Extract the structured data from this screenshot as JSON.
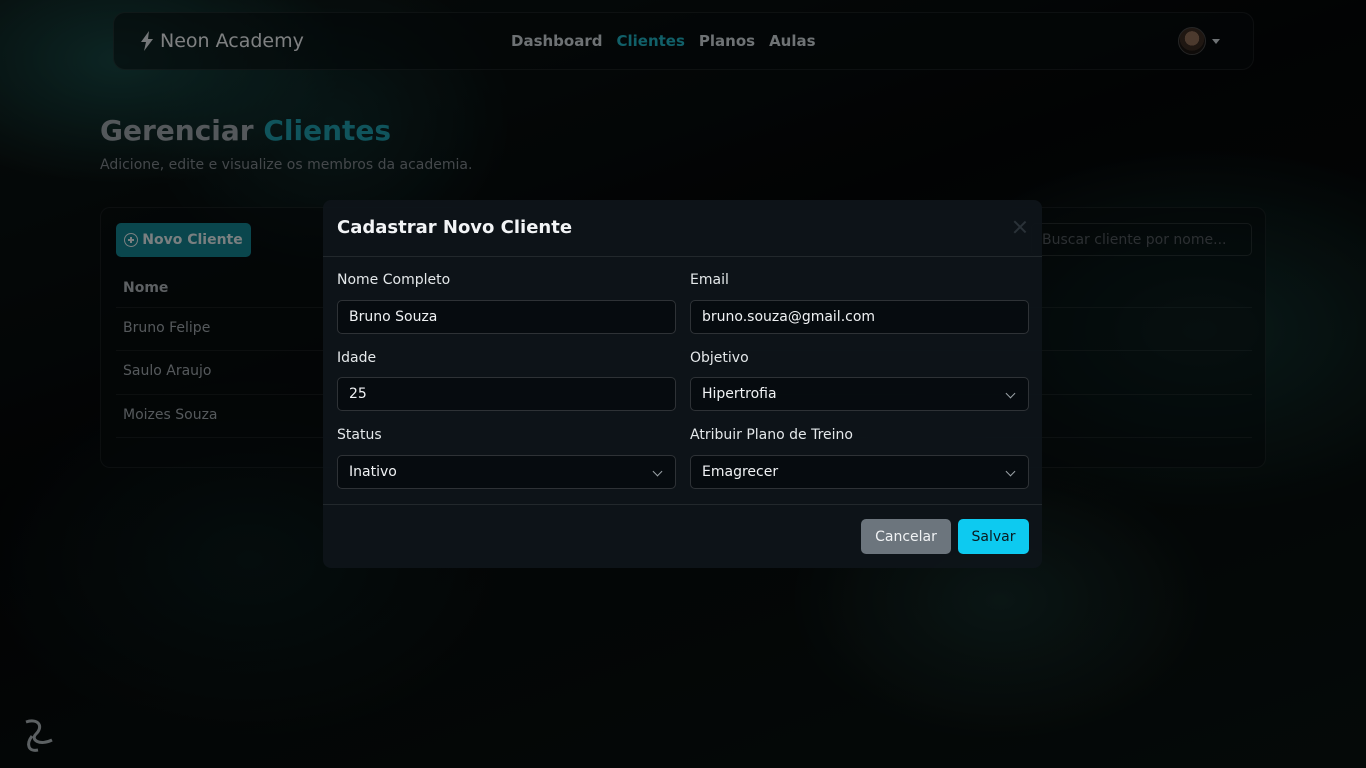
{
  "navbar": {
    "brand": "Neon Academy",
    "links": [
      {
        "label": "Dashboard",
        "active": false
      },
      {
        "label": "Clientes",
        "active": true
      },
      {
        "label": "Planos",
        "active": false
      },
      {
        "label": "Aulas",
        "active": false
      }
    ]
  },
  "page": {
    "title_part1": "Gerenciar",
    "title_part2": "Clientes",
    "subtitle": "Adicione, edite e visualize os membros da academia."
  },
  "clients_card": {
    "new_button_label": "Novo Cliente",
    "search_placeholder": "Buscar cliente por nome...",
    "column_name": "Nome",
    "rows": [
      "Bruno Felipe",
      "Saulo Araujo",
      "Moizes Souza"
    ]
  },
  "modal": {
    "title": "Cadastrar Novo Cliente",
    "fields": {
      "nome": {
        "label": "Nome Completo",
        "value": "Bruno Souza"
      },
      "email": {
        "label": "Email",
        "value": "bruno.souza@gmail.com"
      },
      "idade": {
        "label": "Idade",
        "value": "25"
      },
      "objetivo": {
        "label": "Objetivo",
        "value": "Hipertrofia"
      },
      "status": {
        "label": "Status",
        "value": "Inativo"
      },
      "plano": {
        "label": "Atribuir Plano de Treino",
        "value": "Emagrecer"
      }
    },
    "cancel_label": "Cancelar",
    "save_label": "Salvar"
  },
  "colors": {
    "accent": "#1e9aa8",
    "save": "#0dcaf0",
    "cancel": "#6c757d"
  }
}
